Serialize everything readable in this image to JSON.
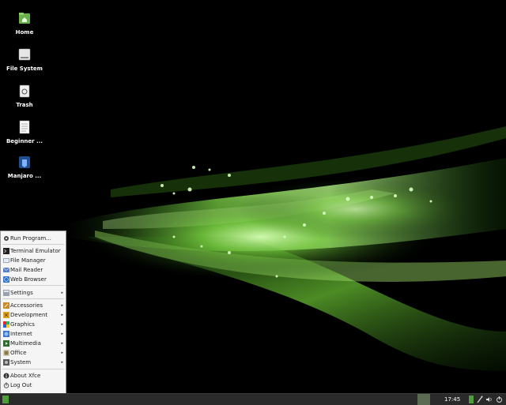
{
  "desktop": {
    "icons": [
      {
        "label": "Home",
        "icon": "home-folder-icon"
      },
      {
        "label": "File System",
        "icon": "drive-icon"
      },
      {
        "label": "Trash",
        "icon": "trash-icon"
      },
      {
        "label": "Beginner ...",
        "icon": "document-icon"
      },
      {
        "label": "Manjaro ...",
        "icon": "manjaro-icon"
      }
    ]
  },
  "menu": {
    "items": [
      {
        "label": "Run Program...",
        "icon": "gear-icon"
      },
      {
        "label": "Terminal Emulator",
        "icon": "terminal-icon"
      },
      {
        "label": "File Manager",
        "icon": "file-manager-icon"
      },
      {
        "label": "Mail Reader",
        "icon": "mail-icon"
      },
      {
        "label": "Web Browser",
        "icon": "web-icon"
      },
      {
        "label": "Settings",
        "icon": "settings-icon",
        "submenu": true
      },
      {
        "label": "Accessories",
        "icon": "accessories-icon",
        "submenu": true
      },
      {
        "label": "Development",
        "icon": "development-icon",
        "submenu": true
      },
      {
        "label": "Graphics",
        "icon": "graphics-icon",
        "submenu": true
      },
      {
        "label": "Internet",
        "icon": "internet-icon",
        "submenu": true
      },
      {
        "label": "Multimedia",
        "icon": "multimedia-icon",
        "submenu": true
      },
      {
        "label": "Office",
        "icon": "office-icon",
        "submenu": true
      },
      {
        "label": "System",
        "icon": "system-icon",
        "submenu": true
      },
      {
        "label": "About Xfce",
        "icon": "info-icon"
      },
      {
        "label": "Log Out",
        "icon": "logout-icon"
      }
    ],
    "submenu_arrow": "▸"
  },
  "panel": {
    "clock": "17:45"
  },
  "colors": {
    "accent_green": "#4f9d3a",
    "panel_bg": "#2a2a2a",
    "menu_bg": "#f5f5f5"
  }
}
